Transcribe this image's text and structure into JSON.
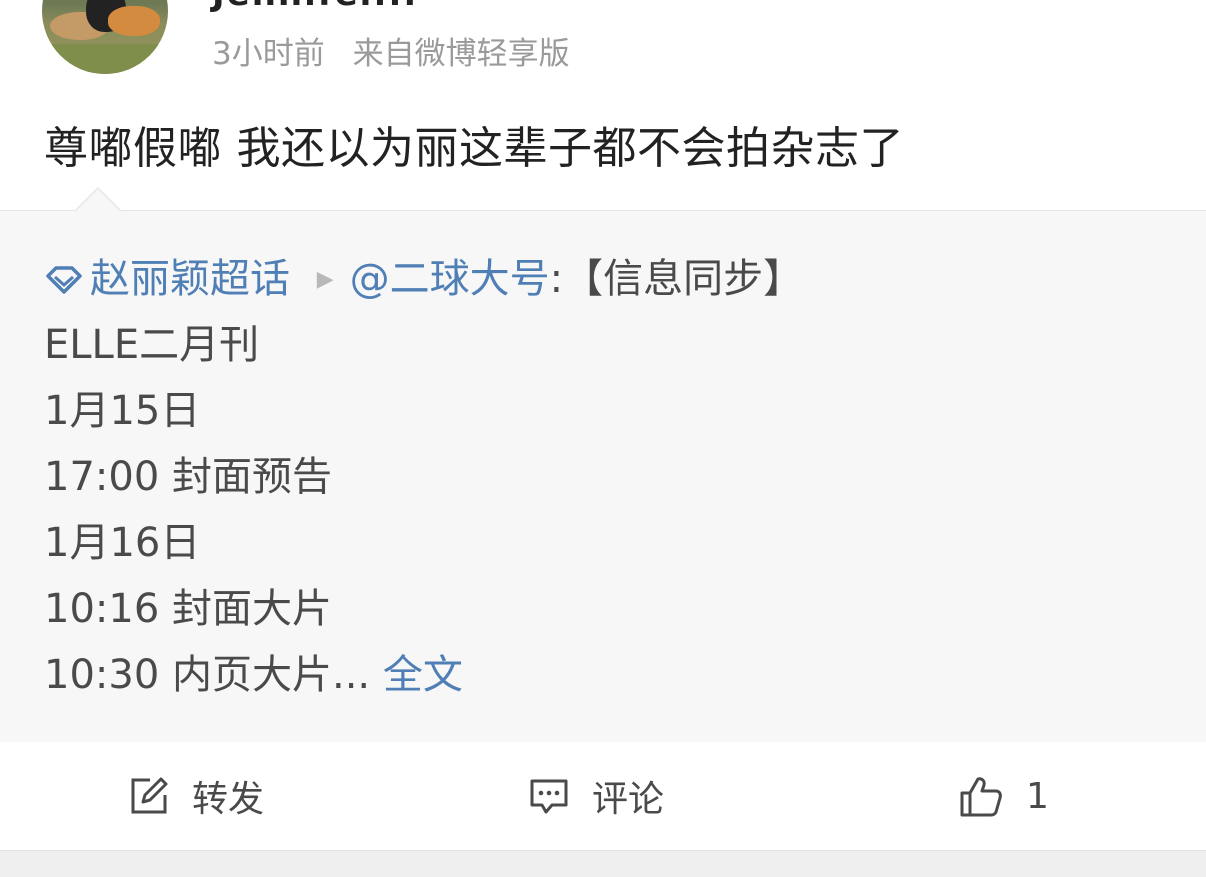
{
  "header": {
    "username": "Jennifer...",
    "time": "3小时前",
    "source": "来自微博轻享版"
  },
  "post": {
    "text": "尊嘟假嘟 我还以为丽这辈子都不会拍杂志了"
  },
  "repost": {
    "topic": "赵丽颖超话",
    "mention": "@二球大号",
    "title": ":【信息同步】",
    "lines": [
      "ELLE二月刊",
      "1月15日",
      "17:00 封面预告",
      "1月16日",
      "10:16 封面大片",
      "10:30 内页大片..."
    ],
    "full_text_link": "全文"
  },
  "actions": {
    "repost_label": "转发",
    "comment_label": "评论",
    "like_count": "1"
  },
  "colors": {
    "link": "#4f7fb5",
    "text": "#222222",
    "meta": "#9a9a9a",
    "repost_bg": "#f7f7f7"
  },
  "icons": [
    "diamond-icon",
    "arrow-right-icon",
    "share-edit-icon",
    "comment-icon",
    "thumbs-up-icon"
  ]
}
